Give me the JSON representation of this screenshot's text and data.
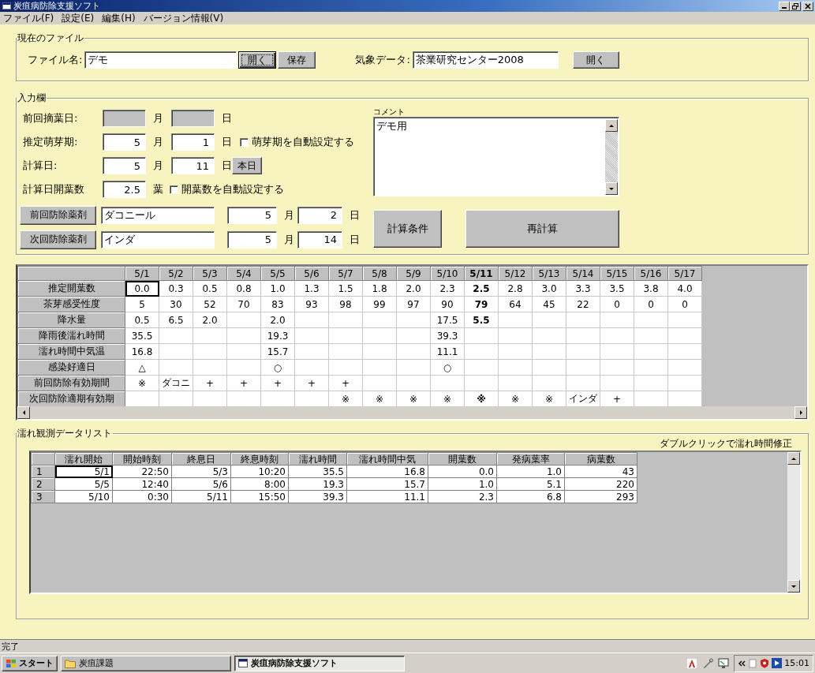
{
  "window": {
    "title": "炭疽病防除支援ソフト"
  },
  "menu": [
    {
      "label": "ファイル(F)"
    },
    {
      "label": "設定(E)"
    },
    {
      "label": "編集(H)"
    },
    {
      "label": "バージョン情報(V)"
    }
  ],
  "current_file": {
    "title": "現在のファイル",
    "file_label": "ファイル名:",
    "file_name": "デモ",
    "buttons": [
      {
        "label": "開く",
        "focused": true
      },
      {
        "label": "保存",
        "focused": false
      }
    ],
    "weather_label": "気象データ:",
    "weather_value": "茶業研究センター2008",
    "weather_button": "開く"
  },
  "input": {
    "title": "入力欄",
    "date_rows": [
      {
        "label": "前回摘葉日:",
        "disabled": true,
        "month_unit": "月",
        "day_unit": "日"
      },
      {
        "label": "推定萌芽期:",
        "disabled": false,
        "month": "5",
        "month_unit": "月",
        "day": "1",
        "day_unit": "日",
        "checkbox": {
          "label": "萌芽期を自動設定する",
          "checked": false
        }
      },
      {
        "label": "計算日:",
        "disabled": false,
        "month": "5",
        "month_unit": "月",
        "day": "11",
        "day_unit": "日",
        "button": "本日"
      }
    ],
    "leaf_count": {
      "label": "計算日開葉数",
      "value": "2.5",
      "unit": "葉",
      "checkbox": {
        "label": "開葉数を自動設定する",
        "checked": false
      }
    },
    "sprays": [
      {
        "button": "前回防除薬剤",
        "agent": "ダコニール",
        "month": "5",
        "month_unit": "月",
        "day": "2",
        "day_unit": "日"
      },
      {
        "button": "次回防除薬剤",
        "agent": "インダ",
        "month": "5",
        "month_unit": "月",
        "day": "14",
        "day_unit": "日"
      }
    ],
    "comment": {
      "label": "コメント",
      "value": "デモ用"
    },
    "actions": [
      "計算条件",
      "再計算"
    ]
  },
  "forecast_grid": {
    "columns": [
      {
        "label": "5/1",
        "selected": false
      },
      {
        "label": "5/2",
        "selected": false
      },
      {
        "label": "5/3",
        "selected": false
      },
      {
        "label": "5/4",
        "selected": false
      },
      {
        "label": "5/5",
        "selected": false
      },
      {
        "label": "5/6",
        "selected": false
      },
      {
        "label": "5/7",
        "selected": false
      },
      {
        "label": "5/8",
        "selected": false
      },
      {
        "label": "5/9",
        "selected": false
      },
      {
        "label": "5/10",
        "selected": false
      },
      {
        "label": "5/11",
        "selected": true
      },
      {
        "label": "5/12",
        "selected": false
      },
      {
        "label": "5/13",
        "selected": false
      },
      {
        "label": "5/14",
        "selected": false
      },
      {
        "label": "5/15",
        "selected": false
      },
      {
        "label": "5/16",
        "selected": false
      },
      {
        "label": "5/17",
        "selected": false
      }
    ],
    "rows": [
      {
        "label": "推定開葉数",
        "cells": [
          {
            "text": "0.0",
            "focused": true
          },
          "0.3",
          "0.5",
          "0.8",
          "1.0",
          "1.3",
          "1.5",
          "1.8",
          "2.0",
          "2.3",
          "2.5",
          "2.8",
          "3.0",
          "3.3",
          "3.5",
          "3.8",
          "4.0"
        ]
      },
      {
        "label": "茶芽感受性度",
        "cells": [
          "5",
          "30",
          "52",
          "70",
          "83",
          "93",
          "98",
          "99",
          "97",
          "90",
          "79",
          "64",
          "45",
          "22",
          "0",
          "0",
          "0"
        ]
      },
      {
        "label": "降水量",
        "cells": [
          "0.5",
          "6.5",
          "2.0",
          null,
          "2.0",
          null,
          null,
          null,
          null,
          "17.5",
          "5.5",
          null,
          null,
          null,
          null,
          null,
          null
        ]
      },
      {
        "label": "降雨後濡れ時間",
        "cells": [
          "35.5",
          null,
          null,
          null,
          "19.3",
          null,
          null,
          null,
          null,
          "39.3",
          null,
          null,
          null,
          null,
          null,
          null,
          null
        ]
      },
      {
        "label": "濡れ時間中気温",
        "cells": [
          "16.8",
          null,
          null,
          null,
          "15.7",
          null,
          null,
          null,
          null,
          "11.1",
          null,
          null,
          null,
          null,
          null,
          null,
          null
        ]
      },
      {
        "label": "感染好適日",
        "cells": [
          "△",
          null,
          null,
          null,
          "○",
          null,
          null,
          null,
          null,
          "○",
          null,
          null,
          null,
          null,
          null,
          null,
          null
        ]
      },
      {
        "label": "前回防除有効期間",
        "cells": [
          "※",
          "ダコニ",
          "+",
          "+",
          "+",
          "+",
          "+",
          null,
          null,
          null,
          null,
          null,
          null,
          null,
          null,
          null,
          null
        ]
      },
      {
        "label": "次回防除適期有効期",
        "cells": [
          null,
          null,
          null,
          null,
          null,
          null,
          "※",
          "※",
          "※",
          "※",
          "※",
          "※",
          "※",
          "インダ",
          "+",
          null,
          null
        ]
      }
    ]
  },
  "wetness_list": {
    "title": "濡れ観測データリスト",
    "hint": "ダブルクリックで濡れ時間修正",
    "columns": [
      {
        "label": "濡れ開始"
      },
      {
        "label": "開始時刻"
      },
      {
        "label": "終息日"
      },
      {
        "label": "終息時刻"
      },
      {
        "label": "濡れ時間"
      },
      {
        "label": "濡れ時間中気"
      },
      {
        "label": "開葉数"
      },
      {
        "label": "発病葉率"
      },
      {
        "label": "病葉数"
      }
    ],
    "rows": [
      {
        "number": "1",
        "cells": [
          {
            "text": "5/1",
            "focused": true
          },
          "22:50",
          "5/3",
          "10:20",
          "35.5",
          "16.8",
          "0.0",
          "1.0",
          "43"
        ]
      },
      {
        "number": "2",
        "cells": [
          "5/5",
          "12:40",
          "5/6",
          "8:00",
          "19.3",
          "15.7",
          "1.0",
          "5.1",
          "220"
        ]
      },
      {
        "number": "3",
        "cells": [
          "5/10",
          "0:30",
          "5/11",
          "15:50",
          "39.3",
          "11.1",
          "2.3",
          "6.8",
          "293"
        ]
      }
    ]
  },
  "status_bar": {
    "text": "完了"
  },
  "taskbar": {
    "start": "スタート",
    "tasks": [
      {
        "label": "炭疽課題",
        "kind": "folder",
        "selected": false
      },
      {
        "label": "炭疽病防除支援ソフト",
        "kind": "window",
        "selected": true
      }
    ],
    "clock": "15:01"
  }
}
